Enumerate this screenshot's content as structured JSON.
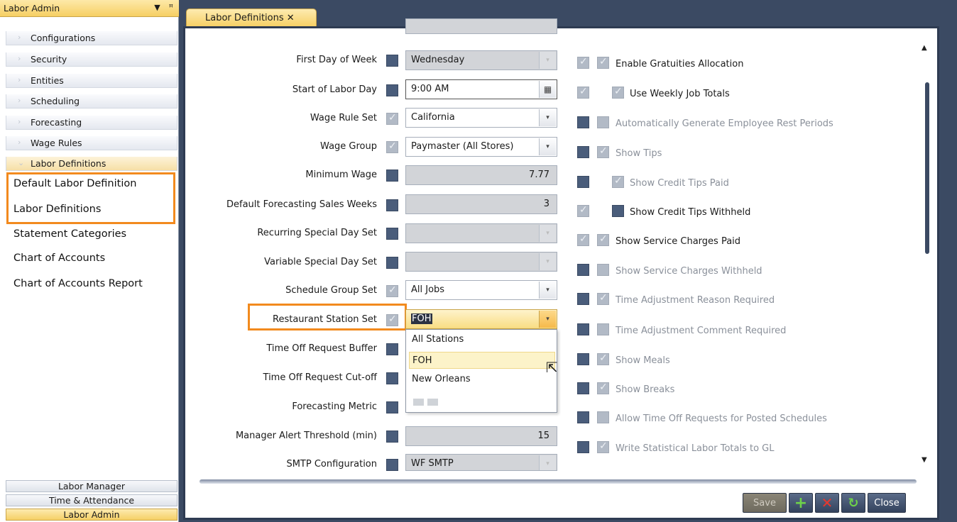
{
  "sidebar": {
    "title": "Labor Admin",
    "pin_icon": "pin-icon",
    "groups": [
      "Configurations",
      "Security",
      "Entities",
      "Scheduling",
      "Forecasting",
      "Wage Rules",
      "Labor Definitions"
    ],
    "links": [
      "Default Labor Definition",
      "Labor Definitions",
      "Statement Categories",
      "Chart of Accounts",
      "Chart of Accounts Report"
    ],
    "bottom": [
      "Labor Manager",
      "Time & Attendance",
      "Labor Admin"
    ]
  },
  "tab": {
    "label": "Labor Definitions ✕"
  },
  "form": {
    "rows": [
      {
        "label": "First Day of Week",
        "checked": false,
        "value": "Wednesday"
      },
      {
        "label": "Start of Labor Day",
        "checked": false,
        "value": "9:00 AM"
      },
      {
        "label": "Wage Rule Set",
        "checked": true,
        "value": "California"
      },
      {
        "label": "Wage Group",
        "checked": true,
        "value": "Paymaster (All Stores)"
      },
      {
        "label": "Minimum Wage",
        "checked": false,
        "value": "7.77"
      },
      {
        "label": "Default Forecasting Sales Weeks",
        "checked": false,
        "value": "3"
      },
      {
        "label": "Recurring Special Day Set",
        "checked": false,
        "value": ""
      },
      {
        "label": "Variable Special Day Set",
        "checked": false,
        "value": ""
      },
      {
        "label": "Schedule Group Set",
        "checked": true,
        "value": "All Jobs"
      },
      {
        "label": "Restaurant Station Set",
        "checked": true,
        "value": "FOH"
      },
      {
        "label": "Time Off Request Buffer",
        "checked": false,
        "value": ""
      },
      {
        "label": "Time Off Request Cut-off",
        "checked": false,
        "value": ""
      },
      {
        "label": "Forecasting Metric",
        "checked": false,
        "value": ""
      },
      {
        "label": "Manager Alert Threshold (min)",
        "checked": false,
        "value": "15"
      },
      {
        "label": "SMTP Configuration",
        "checked": false,
        "value": "WF SMTP"
      }
    ],
    "dropdown_options": [
      "All Stations",
      "FOH",
      "New Orleans"
    ],
    "options": [
      {
        "label": "Enable Gratuities Allocation"
      },
      {
        "label": "Use Weekly Job Totals"
      },
      {
        "label": "Automatically Generate Employee Rest Periods"
      },
      {
        "label": "Show Tips"
      },
      {
        "label": "Show Credit Tips Paid"
      },
      {
        "label": "Show Credit Tips Withheld"
      },
      {
        "label": "Show Service Charges Paid"
      },
      {
        "label": "Show Service Charges Withheld"
      },
      {
        "label": "Time Adjustment Reason Required"
      },
      {
        "label": "Time Adjustment Comment Required"
      },
      {
        "label": "Show Meals"
      },
      {
        "label": "Show Breaks"
      },
      {
        "label": "Allow Time Off Requests for Posted Schedules"
      },
      {
        "label": "Write Statistical Labor Totals to GL"
      }
    ]
  },
  "buttons": {
    "save": "Save",
    "close": "Close"
  }
}
